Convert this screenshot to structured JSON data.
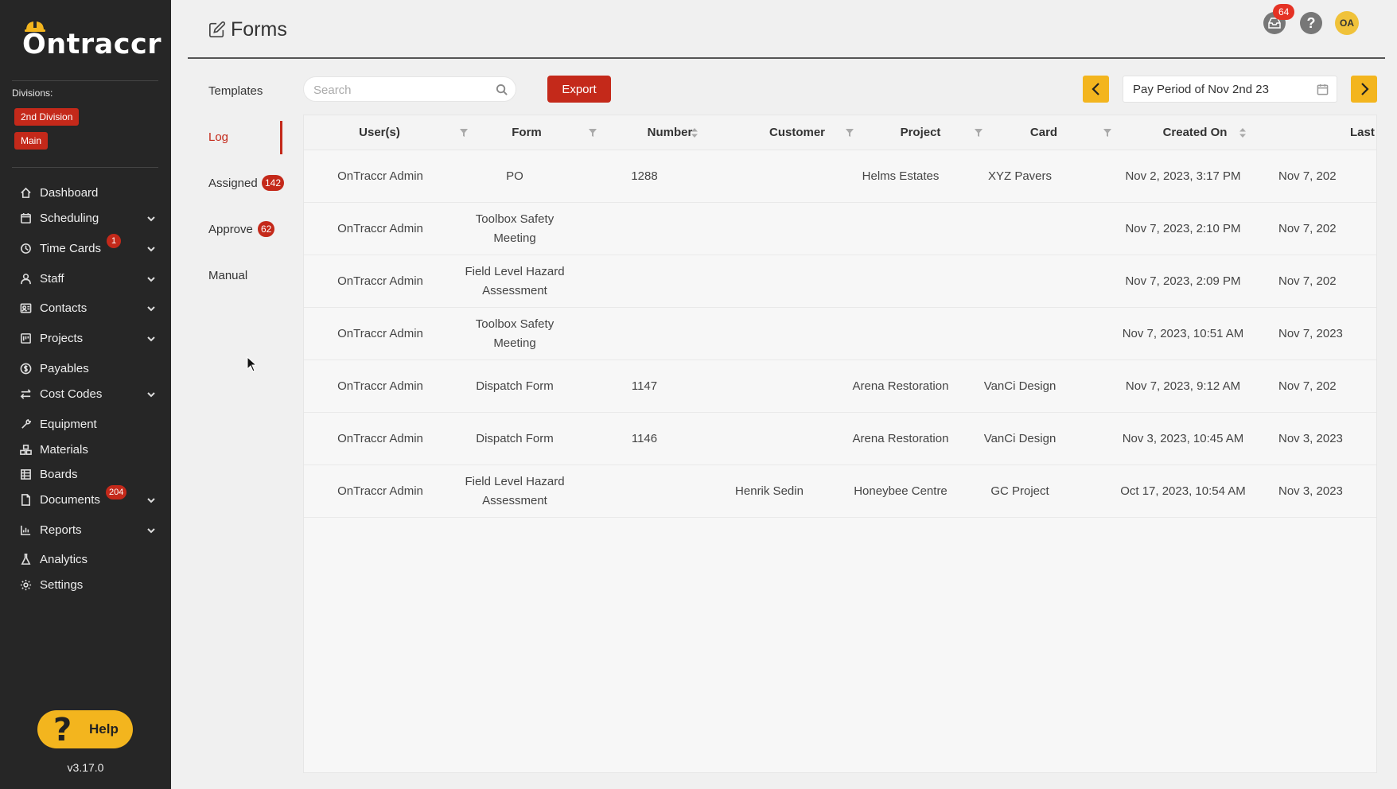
{
  "brand": {
    "name": "Ontraccr"
  },
  "sidebar": {
    "divisions_label": "Divisions:",
    "divisions": [
      "2nd Division",
      "Main"
    ],
    "items": [
      {
        "label": "Dashboard",
        "icon": "home-icon",
        "chevron": false
      },
      {
        "label": "Scheduling",
        "icon": "calendar-icon",
        "chevron": true
      },
      {
        "label": "Time Cards",
        "icon": "clock-icon",
        "chevron": true,
        "badge": "1"
      },
      {
        "label": "Staff",
        "icon": "user-icon",
        "chevron": true
      },
      {
        "label": "Contacts",
        "icon": "contacts-icon",
        "chevron": true
      },
      {
        "label": "Projects",
        "icon": "projects-icon",
        "chevron": true
      },
      {
        "label": "Payables",
        "icon": "dollar-icon",
        "chevron": false
      },
      {
        "label": "Cost Codes",
        "icon": "swap-icon",
        "chevron": true
      },
      {
        "label": "Equipment",
        "icon": "tool-icon",
        "chevron": false
      },
      {
        "label": "Materials",
        "icon": "materials-icon",
        "chevron": false
      },
      {
        "label": "Boards",
        "icon": "boards-icon",
        "chevron": false
      },
      {
        "label": "Documents",
        "icon": "document-icon",
        "chevron": true,
        "badge": "204"
      },
      {
        "label": "Reports",
        "icon": "chart-icon",
        "chevron": true
      },
      {
        "label": "Analytics",
        "icon": "flask-icon",
        "chevron": false
      },
      {
        "label": "Settings",
        "icon": "gear-icon",
        "chevron": false
      }
    ],
    "help_label": "Help",
    "version": "v3.17.0"
  },
  "header": {
    "title": "Forms",
    "notifications_count": "64",
    "avatar_initials": "OA"
  },
  "tabs": [
    {
      "label": "Templates"
    },
    {
      "label": "Log",
      "active": true
    },
    {
      "label": "Assigned",
      "badge": "142"
    },
    {
      "label": "Approve",
      "badge": "62"
    },
    {
      "label": "Manual"
    }
  ],
  "toolbar": {
    "search_placeholder": "Search",
    "export_label": "Export",
    "period_label": "Pay Period of Nov 2nd 23"
  },
  "table": {
    "columns": [
      "User(s)",
      "Form",
      "Number",
      "Customer",
      "Project",
      "Card",
      "Created On",
      "Last Up"
    ],
    "rows": [
      {
        "user": "OnTraccr Admin",
        "form": "PO",
        "number": "1288",
        "customer": "",
        "project": "Helms Estates",
        "card": "XYZ Pavers",
        "created": "Nov 2, 2023, 3:17 PM",
        "last": "Nov 7, 202"
      },
      {
        "user": "OnTraccr Admin",
        "form": "Toolbox Safety Meeting",
        "number": "",
        "customer": "",
        "project": "",
        "card": "",
        "created": "Nov 7, 2023, 2:10 PM",
        "last": "Nov 7, 202"
      },
      {
        "user": "OnTraccr Admin",
        "form": "Field Level Hazard Assessment",
        "number": "",
        "customer": "",
        "project": "",
        "card": "",
        "created": "Nov 7, 2023, 2:09 PM",
        "last": "Nov 7, 202"
      },
      {
        "user": "OnTraccr Admin",
        "form": "Toolbox Safety Meeting",
        "number": "",
        "customer": "",
        "project": "",
        "card": "",
        "created": "Nov 7, 2023, 10:51 AM",
        "last": "Nov 7, 2023"
      },
      {
        "user": "OnTraccr Admin",
        "form": "Dispatch Form",
        "number": "1147",
        "customer": "",
        "project": "Arena Restoration",
        "card": "VanCi Design",
        "created": "Nov 7, 2023, 9:12 AM",
        "last": "Nov 7, 202"
      },
      {
        "user": "OnTraccr Admin",
        "form": "Dispatch Form",
        "number": "1146",
        "customer": "",
        "project": "Arena Restoration",
        "card": "VanCi Design",
        "created": "Nov 3, 2023, 10:45 AM",
        "last": "Nov 3, 2023"
      },
      {
        "user": "OnTraccr Admin",
        "form": "Field Level Hazard Assessment",
        "number": "",
        "customer": "Henrik Sedin",
        "project": "Honeybee Centre",
        "card": "GC Project",
        "created": "Oct 17, 2023, 10:54 AM",
        "last": "Nov 3, 2023"
      }
    ]
  },
  "colors": {
    "accent": "#c4291a",
    "warning": "#f3b51e",
    "sidebar": "#262626"
  }
}
